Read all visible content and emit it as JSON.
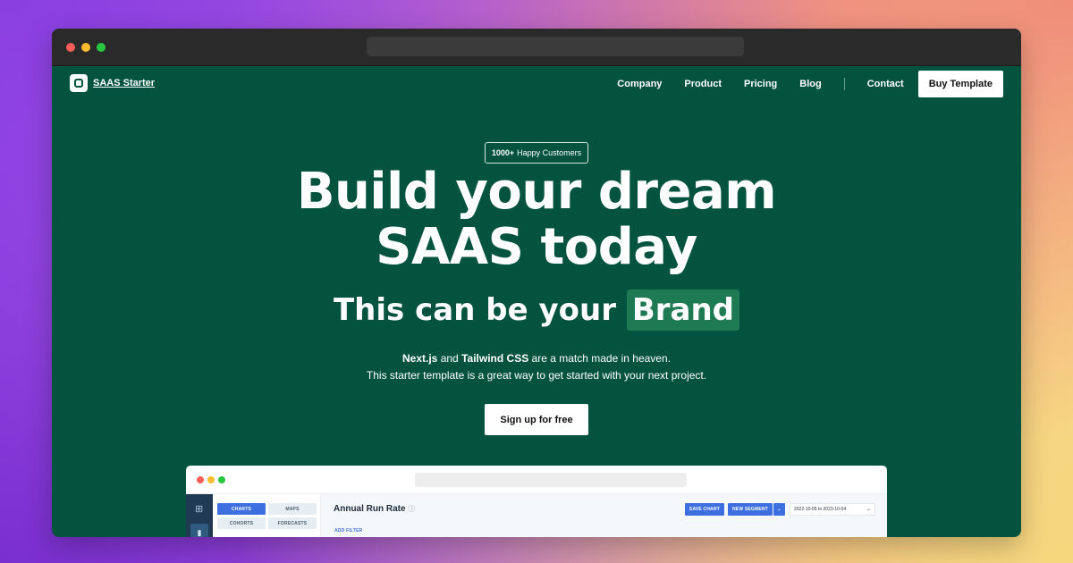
{
  "nav": {
    "logo_text": "SAAS Starter",
    "links": [
      "Company",
      "Product",
      "Pricing",
      "Blog",
      "Contact"
    ],
    "buy_label": "Buy Template"
  },
  "hero": {
    "badge_count": "1000+",
    "badge_text": "Happy Customers",
    "title_line1": "Build your dream",
    "title_line2": "SAAS today",
    "subtitle_prefix": "This can be your",
    "subtitle_highlight": "Brand",
    "desc_bold1": "Next.js",
    "desc_and": "and",
    "desc_bold2": "Tailwind CSS",
    "desc_rest": "are a match made in heaven.",
    "desc_line2": "This starter template is a great way to get started with your next project.",
    "cta_label": "Sign up for free"
  },
  "preview": {
    "tabs": [
      "CHARTS",
      "MAPS",
      "COHORTS",
      "FORECASTS"
    ],
    "title": "Annual Run Rate",
    "save_chart": "SAVE CHART",
    "new_segment": "NEW SEGMENT",
    "date_range": "2022-10-05 to 2023-10-04",
    "add_filter": "ADD FILTER"
  },
  "colors": {
    "brand_green": "#04533f",
    "highlight_green": "#1d7a52",
    "accent_blue": "#3d6fe0"
  }
}
